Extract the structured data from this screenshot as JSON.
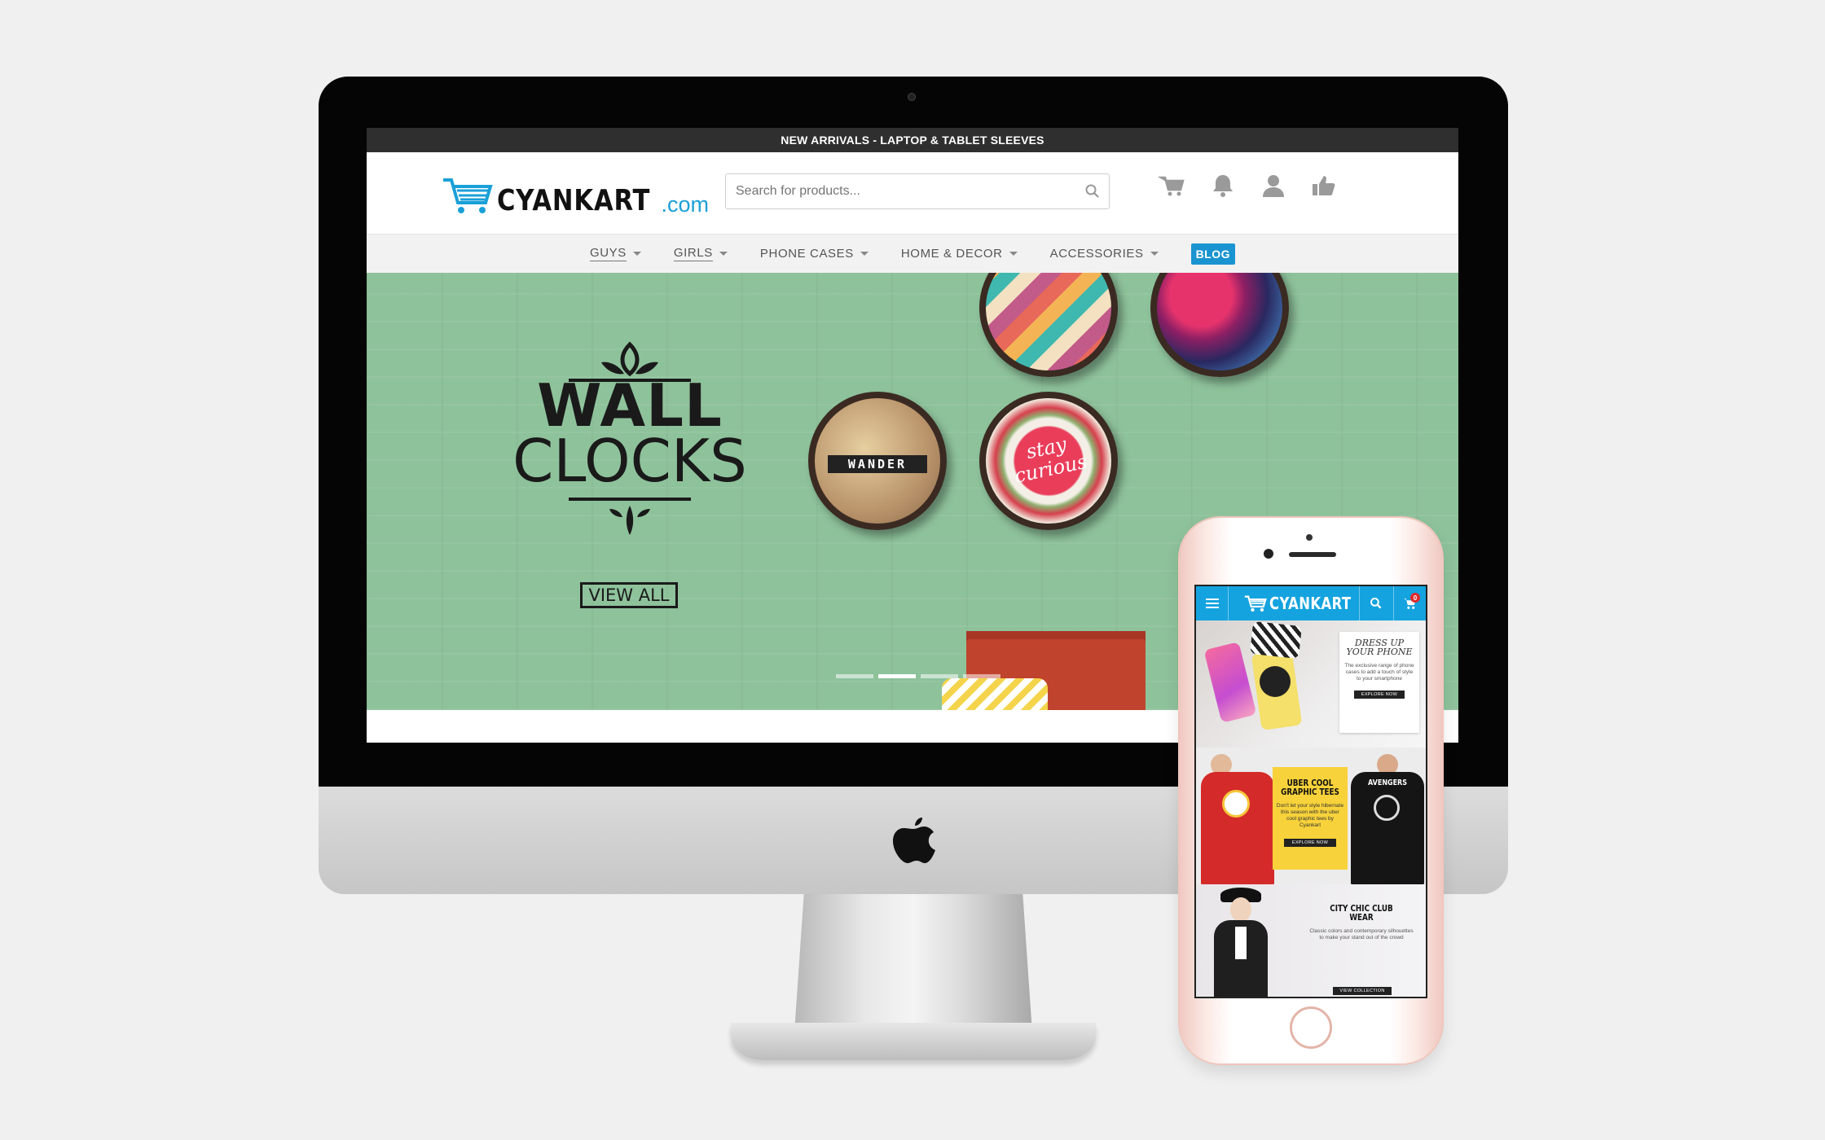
{
  "desktop": {
    "announcement": "NEW ARRIVALS - LAPTOP & TABLET SLEEVES",
    "logo": {
      "name": "CYANKART",
      "domain": ".com"
    },
    "search": {
      "placeholder": "Search for products..."
    },
    "header_icons": [
      "cart-icon",
      "bell-icon",
      "user-icon",
      "thumbs-up-icon"
    ],
    "nav": [
      {
        "label": "GUYS"
      },
      {
        "label": "GIRLS"
      },
      {
        "label": "PHONE CASES"
      },
      {
        "label": "HOME & DECOR"
      },
      {
        "label": "ACCESSORIES"
      }
    ],
    "blog_label": "BLOG",
    "hero": {
      "title_line1": "WALL",
      "title_line2": "CLOCKS",
      "cta": "VIEW ALL",
      "clock_text_1": "WANDER",
      "clock_text_2": "stay curious",
      "slides": 4,
      "active_slide": 2
    }
  },
  "mobile": {
    "logo": "CYANKART",
    "cart_count": "0",
    "banners": [
      {
        "title": "DRESS UP YOUR PHONE",
        "body": "The exclusive range of phone cases to add a touch of style to your smartphone",
        "cta": "EXPLORE NOW"
      },
      {
        "title": "UBER COOL GRAPHIC TEES",
        "body": "Don't let your style hibernate this season with the uber cool graphic tees by Cyankart",
        "cta": "EXPLORE NOW",
        "tee_label": "AVENGERS"
      },
      {
        "title": "CITY CHIC CLUB WEAR",
        "body": "Classic colors and contemporary silhouettes to make your stand out of the crowd",
        "cta": "VIEW COLLECTION"
      }
    ]
  },
  "colors": {
    "brand": "#1aa0d8",
    "hero_bg": "#8ec29b",
    "topbar": "#2f2f2f",
    "mobile_bar": "#14a3df"
  }
}
